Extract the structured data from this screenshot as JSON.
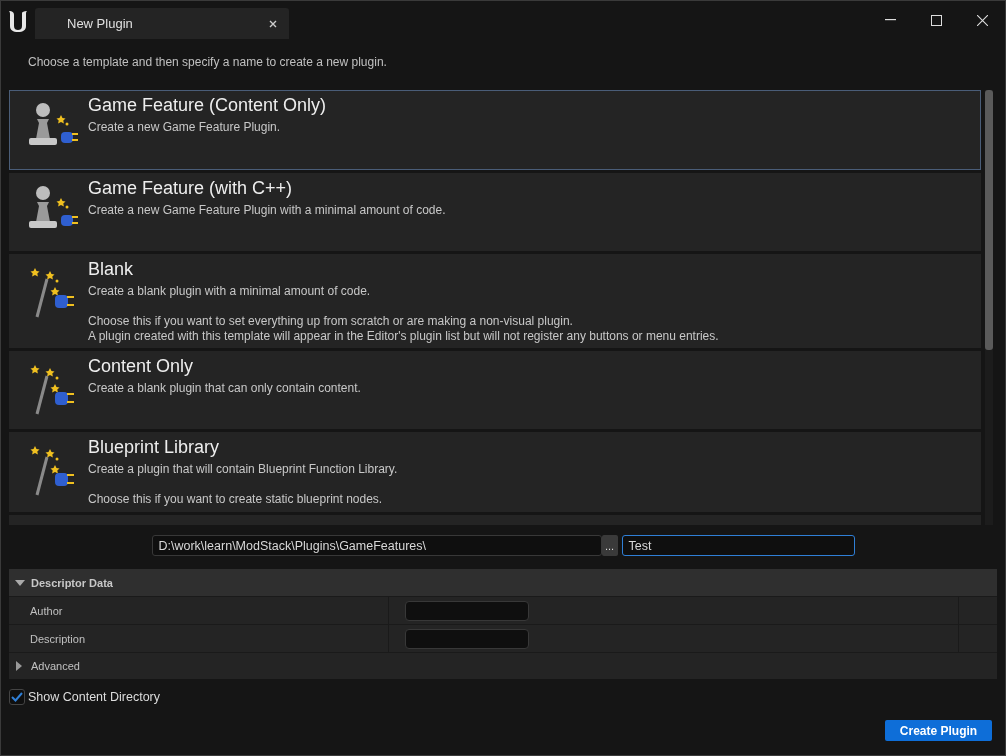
{
  "window": {
    "title": "New Plugin"
  },
  "instruction": "Choose a template and then specify a name to create a new plugin.",
  "templates": [
    {
      "name": "Game Feature (Content Only)",
      "kind": "pawn",
      "selected": true,
      "paragraphs": [
        [
          "Create a new Game Feature Plugin."
        ]
      ]
    },
    {
      "name": "Game Feature (with C++)",
      "kind": "pawn",
      "selected": false,
      "paragraphs": [
        [
          "Create a new Game Feature Plugin with a minimal amount of code."
        ]
      ]
    },
    {
      "name": "Blank",
      "kind": "wand",
      "selected": false,
      "paragraphs": [
        [
          "Create a blank plugin with a minimal amount of code."
        ],
        [
          "Choose this if you want to set everything up from scratch or are making a non-visual plugin.",
          "A plugin created with this template will appear in the Editor's plugin list but will not register any buttons or menu entries."
        ]
      ]
    },
    {
      "name": "Content Only",
      "kind": "wand",
      "selected": false,
      "paragraphs": [
        [
          "Create a blank plugin that can only contain content."
        ]
      ]
    },
    {
      "name": "Blueprint Library",
      "kind": "wand",
      "selected": false,
      "paragraphs": [
        [
          "Create a plugin that will contain Blueprint Function Library."
        ],
        [
          "Choose this if you want to create static blueprint nodes."
        ]
      ]
    }
  ],
  "path_field": {
    "value": "D:\\work\\learn\\ModStack\\Plugins\\GameFeatures\\"
  },
  "browse_button": "...",
  "name_field": {
    "value": "Test"
  },
  "descriptor": {
    "title": "Descriptor Data",
    "expanded": true,
    "fields": [
      {
        "label": "Author"
      },
      {
        "label": "Description"
      }
    ],
    "advanced": {
      "label": "Advanced",
      "expanded": false
    }
  },
  "show_content_directory": {
    "label": "Show Content Directory",
    "checked": true
  },
  "create_button": "Create Plugin"
}
